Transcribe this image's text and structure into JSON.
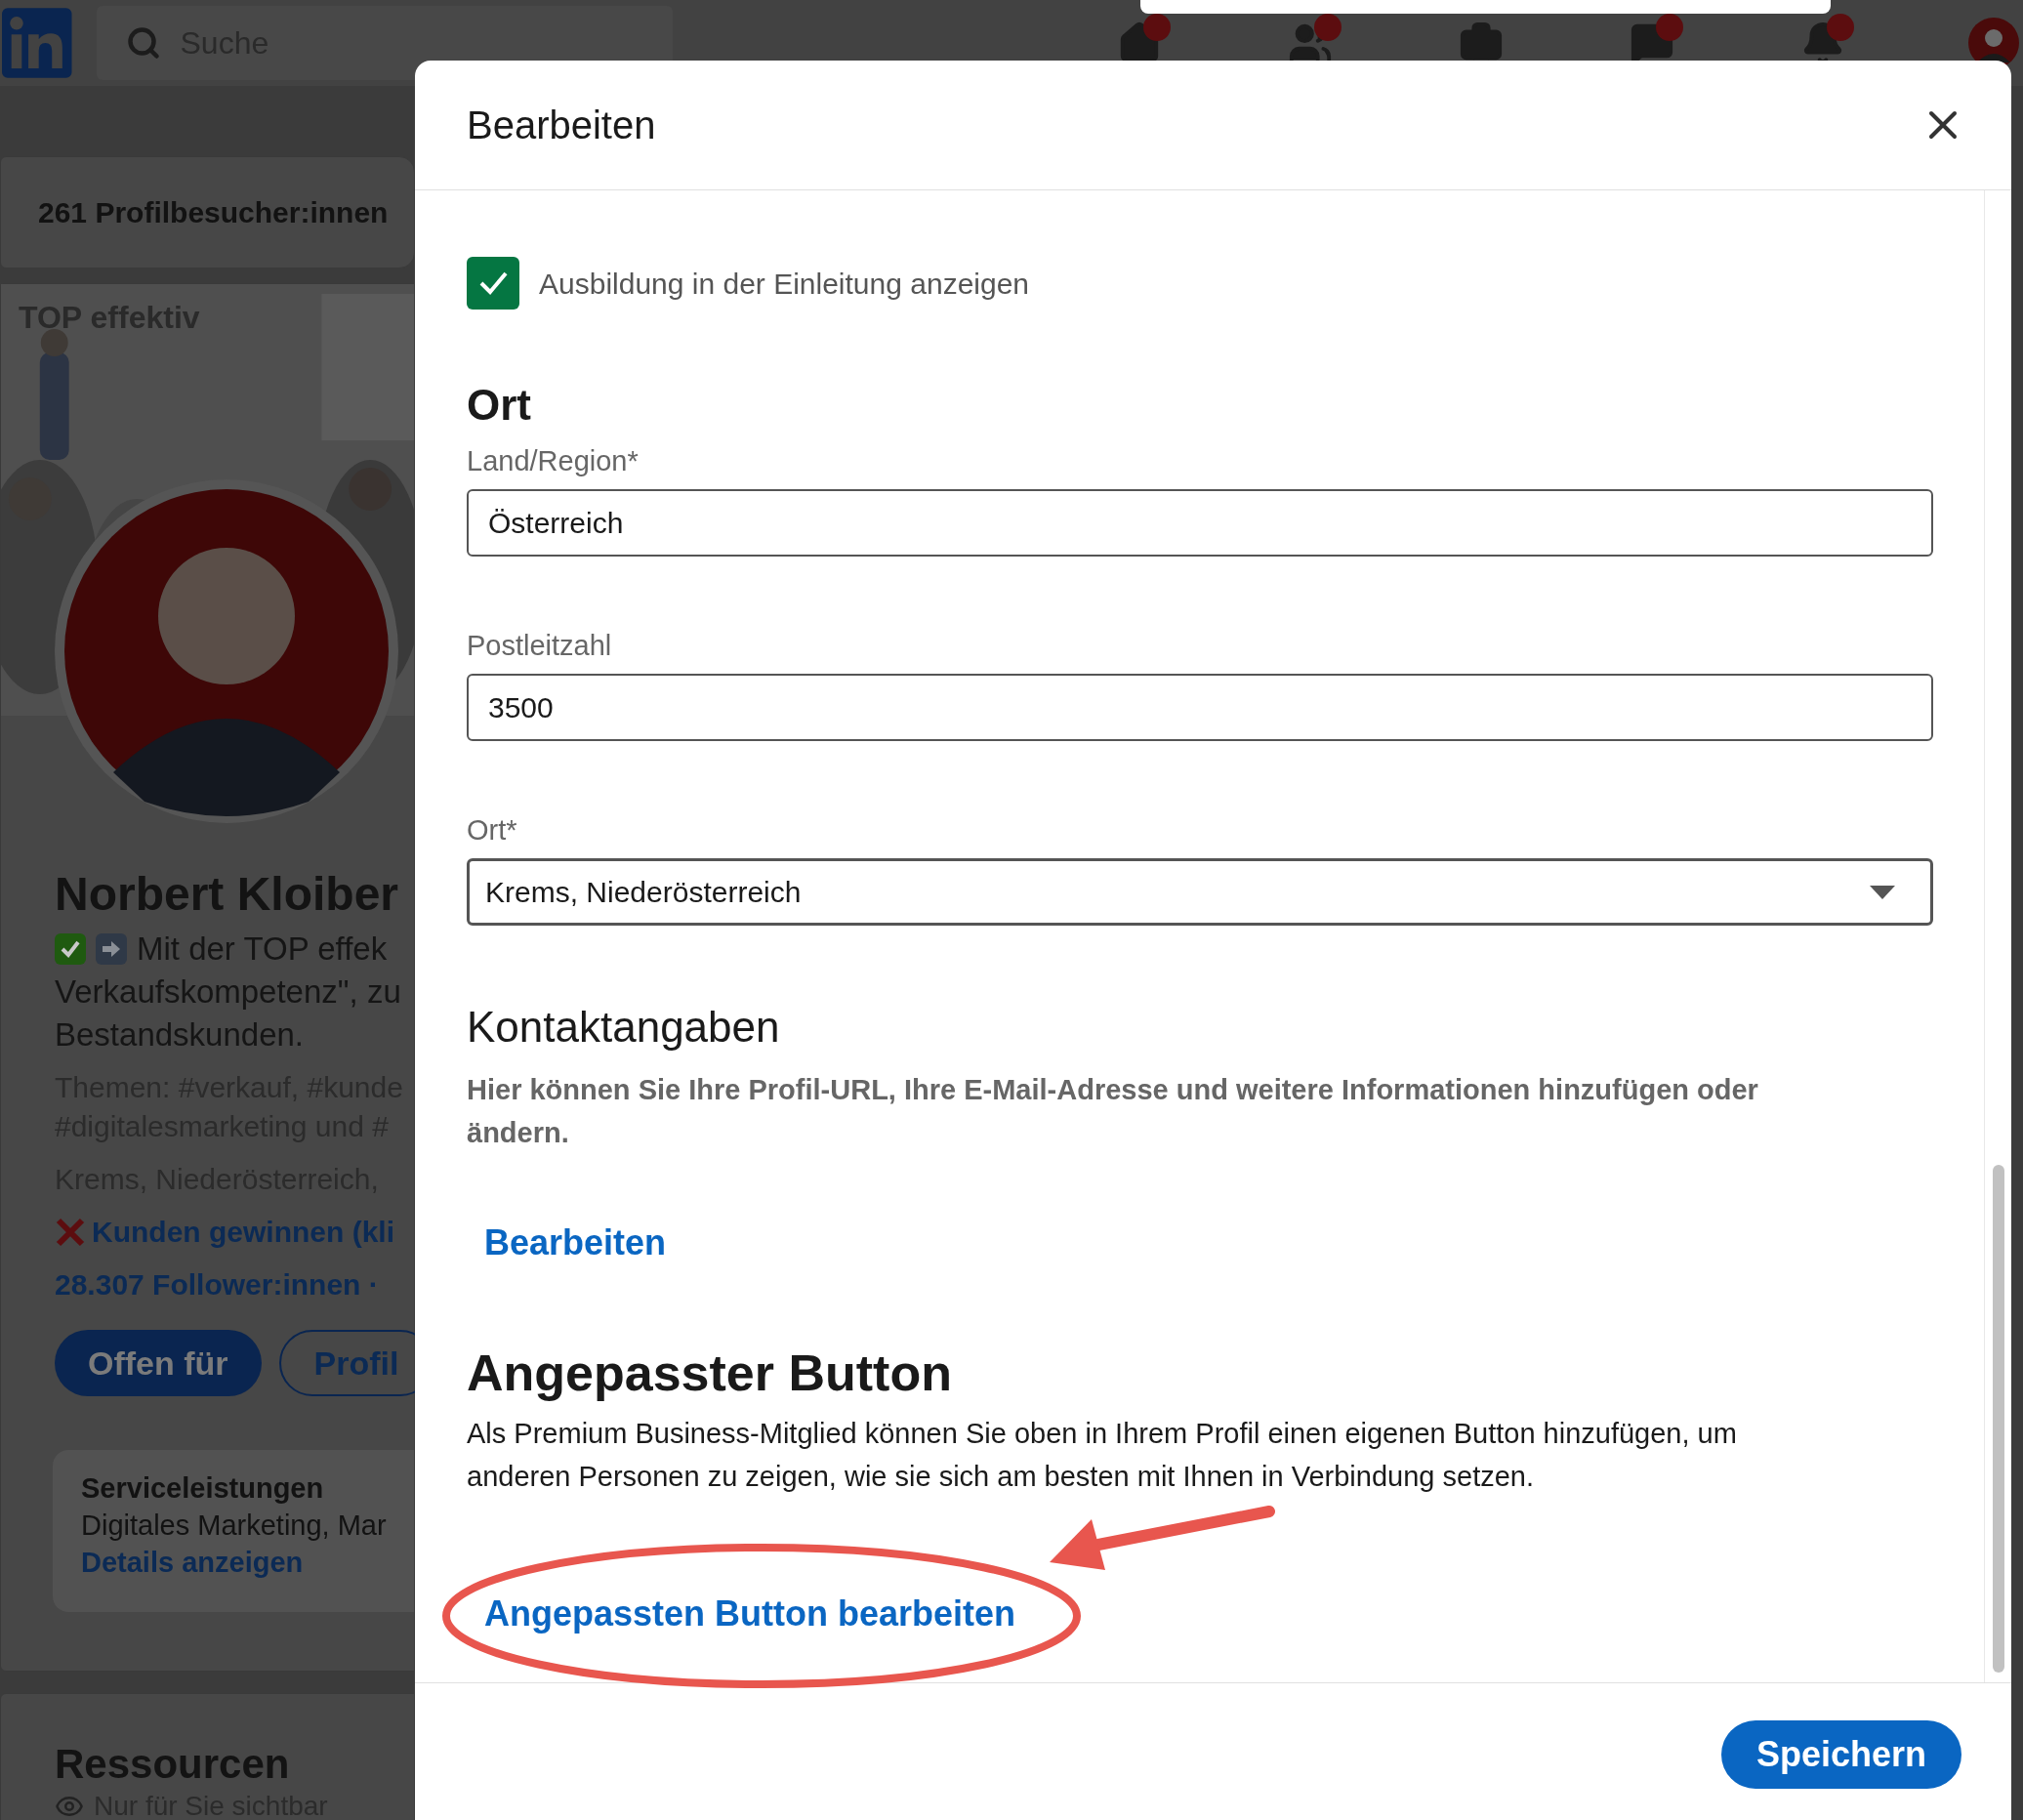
{
  "nav": {
    "search_placeholder": "Suche",
    "items": [
      {
        "kind": "home",
        "badge": true
      },
      {
        "kind": "network",
        "badge": true
      },
      {
        "kind": "jobs",
        "badge": false
      },
      {
        "kind": "messages",
        "badge": true
      },
      {
        "kind": "notifications",
        "badge": true
      },
      {
        "kind": "avatar",
        "badge": false
      }
    ]
  },
  "background": {
    "visitors": "261 Profilbesucher:innen",
    "cover_title": "TOP effektiv",
    "name": "Norbert Kloiber",
    "headline": [
      "Mit der TOP effek",
      "Verkaufskompetenz\", zu",
      "Bestandskunden."
    ],
    "topics": [
      "Themen: #verkauf, #kunde",
      "#digitalesmarketing und #"
    ],
    "location": "Krems, Niederösterreich,",
    "link": "Kunden gewinnen (kli",
    "followers": "28.307 Follower:innen ·",
    "buttons": [
      {
        "label": "Offen für",
        "kind": "primary"
      },
      {
        "label": "Profil",
        "kind": "outline"
      }
    ],
    "services": {
      "title": "Serviceleistungen",
      "text": "Digitales Marketing, Mar",
      "link": "Details anzeigen"
    },
    "resources": {
      "title": "Ressourcen",
      "note": "Nur für Sie sichtbar"
    }
  },
  "modal": {
    "title": "Bearbeiten",
    "education_checkbox": {
      "label": "Ausbildung in der Einleitung anzeigen",
      "checked": true
    },
    "location": {
      "heading": "Ort",
      "fields": [
        {
          "label": "Land/Region*",
          "value": "Österreich",
          "kind": "text"
        },
        {
          "label": "Postleitzahl",
          "value": "3500",
          "kind": "text"
        },
        {
          "label": "Ort*",
          "value": "Krems, Niederösterreich",
          "kind": "select"
        }
      ]
    },
    "contact": {
      "heading": "Kontaktangaben",
      "text": "Hier können Sie Ihre Profil-URL, Ihre E-Mail-Adresse und weitere Informationen hinzufügen oder ändern.",
      "link": "Bearbeiten"
    },
    "custom_button": {
      "heading": "Angepasster Button",
      "text": "Als Premium Business-Mitglied können Sie oben in Ihrem Profil einen eigenen Button hinzufügen, um anderen Personen zu zeigen, wie sie sich am besten mit Ihnen in Verbindung setzen.",
      "link": "Angepassten Button bearbeiten"
    },
    "save": "Speichern"
  }
}
